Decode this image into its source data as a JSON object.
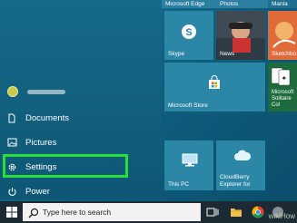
{
  "start_menu": {
    "items": [
      {
        "label": "Documents",
        "icon": "document-icon"
      },
      {
        "label": "Pictures",
        "icon": "pictures-icon"
      },
      {
        "label": "Settings",
        "icon": "gear-icon"
      },
      {
        "label": "Power",
        "icon": "power-icon"
      }
    ]
  },
  "tiles": {
    "top_left_label": "Microsoft Edge",
    "top_right_label": "Photos",
    "top_far_label": "Manla",
    "skype": "Skype",
    "news": "News",
    "sketchbook": "Sketchbo",
    "store": "Microsoft Store",
    "solitaire_line1": "Microsoft",
    "solitaire_line2": "Solitaire Col",
    "this_pc": "This PC",
    "cloudberry_line1": "CloudBerry",
    "cloudberry_line2": "Explorer for"
  },
  "taskbar": {
    "search_placeholder": "Type here to search"
  },
  "watermark": "wikiHow"
}
